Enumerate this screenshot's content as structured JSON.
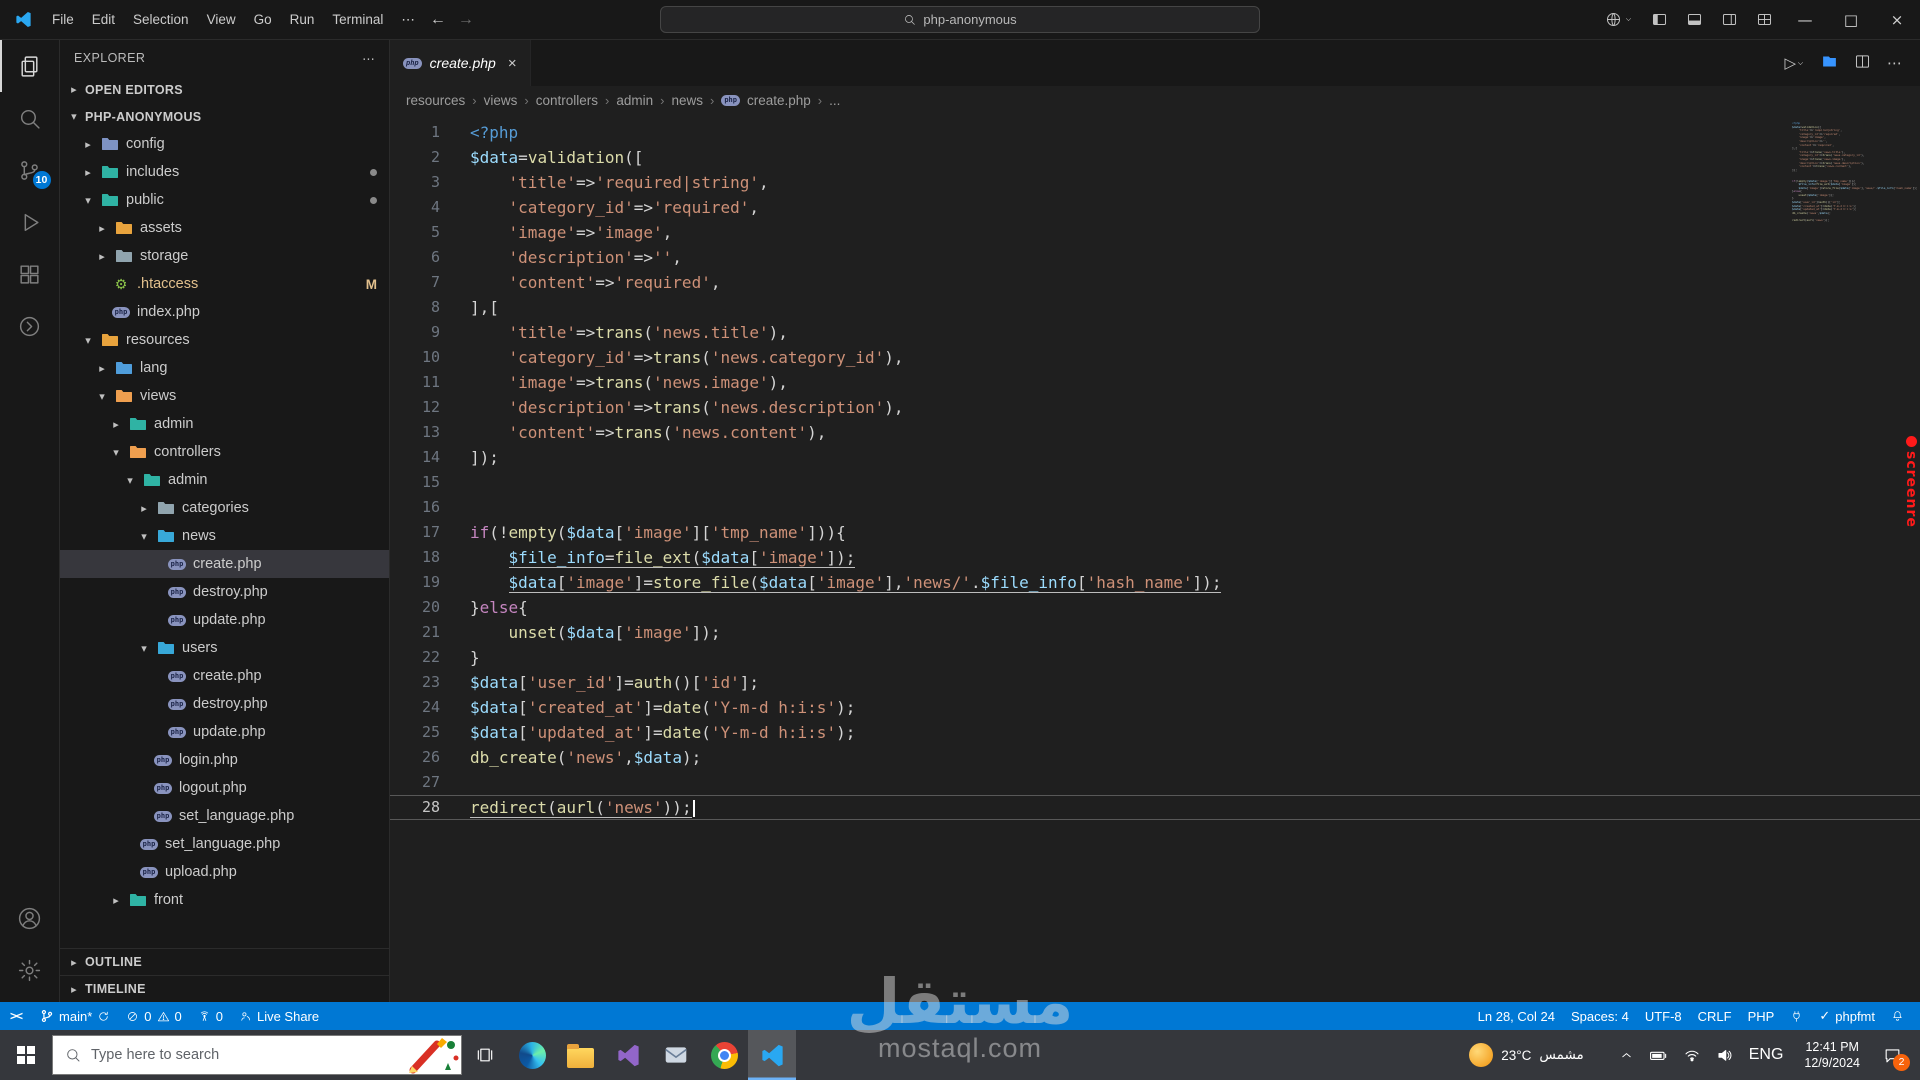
{
  "title_bar": {
    "menus": [
      "File",
      "Edit",
      "Selection",
      "View",
      "Go",
      "Run",
      "Terminal"
    ],
    "search": "php-anonymous"
  },
  "activity_bar": {
    "source_control_badge": "10"
  },
  "sidebar": {
    "title": "EXPLORER",
    "open_editors": "OPEN EDITORS",
    "root": "PHP-ANONYMOUS",
    "outline": "OUTLINE",
    "timeline": "TIMELINE",
    "tree": [
      {
        "label": "config",
        "type": "folder",
        "expanded": false,
        "level": 1,
        "color": "#7e93c4"
      },
      {
        "label": "includes",
        "type": "folder",
        "expanded": false,
        "level": 1,
        "color": "#2fb3a4",
        "dot": true
      },
      {
        "label": "public",
        "type": "folder",
        "expanded": true,
        "level": 1,
        "color": "#2fb3a4",
        "dot": true
      },
      {
        "label": "assets",
        "type": "folder",
        "expanded": false,
        "level": 2,
        "color": "#e8a33d"
      },
      {
        "label": "storage",
        "type": "folder",
        "expanded": false,
        "level": 2,
        "color": "#90a4ae"
      },
      {
        "label": ".htaccess",
        "type": "file",
        "ficon": "gear",
        "level": 2,
        "badge": "M",
        "mod": true
      },
      {
        "label": "index.php",
        "type": "file",
        "ficon": "php",
        "level": 2
      },
      {
        "label": "resources",
        "type": "folder",
        "expanded": true,
        "level": 1,
        "color": "#e8a33d"
      },
      {
        "label": "lang",
        "type": "folder",
        "expanded": false,
        "level": 2,
        "color": "#4f9ddb"
      },
      {
        "label": "views",
        "type": "folder",
        "expanded": true,
        "level": 2,
        "color": "#ef9f4f"
      },
      {
        "label": "admin",
        "type": "folder",
        "expanded": false,
        "level": 3,
        "color": "#2fb3a4"
      },
      {
        "label": "controllers",
        "type": "folder",
        "expanded": true,
        "level": 3,
        "color": "#ef9f4f"
      },
      {
        "label": "admin",
        "type": "folder",
        "expanded": true,
        "level": 4,
        "color": "#2fb3a4"
      },
      {
        "label": "categories",
        "type": "folder",
        "expanded": false,
        "level": 5,
        "color": "#90a4ae"
      },
      {
        "label": "news",
        "type": "folder",
        "expanded": true,
        "level": 5,
        "color": "#38a8d8"
      },
      {
        "label": "create.php",
        "type": "file",
        "ficon": "php",
        "level": 6,
        "selected": true
      },
      {
        "label": "destroy.php",
        "type": "file",
        "ficon": "php",
        "level": 6
      },
      {
        "label": "update.php",
        "type": "file",
        "ficon": "php",
        "level": 6
      },
      {
        "label": "users",
        "type": "folder",
        "expanded": true,
        "level": 5,
        "color": "#38a8d8"
      },
      {
        "label": "create.php",
        "type": "file",
        "ficon": "php",
        "level": 6
      },
      {
        "label": "destroy.php",
        "type": "file",
        "ficon": "php",
        "level": 6
      },
      {
        "label": "update.php",
        "type": "file",
        "ficon": "php",
        "level": 6
      },
      {
        "label": "login.php",
        "type": "file",
        "ficon": "php",
        "level": 5
      },
      {
        "label": "logout.php",
        "type": "file",
        "ficon": "php",
        "level": 5
      },
      {
        "label": "set_language.php",
        "type": "file",
        "ficon": "php",
        "level": 5
      },
      {
        "label": "set_language.php",
        "type": "file",
        "ficon": "php",
        "level": 4
      },
      {
        "label": "upload.php",
        "type": "file",
        "ficon": "php",
        "level": 4
      },
      {
        "label": "front",
        "type": "folder",
        "expanded": false,
        "level": 3,
        "color": "#2fb3a4"
      }
    ]
  },
  "editor": {
    "tab": {
      "label": "create.php"
    },
    "breadcrumbs": [
      "resources",
      "views",
      "controllers",
      "admin",
      "news",
      "create.php",
      "..."
    ],
    "active_line": 28,
    "underlined_lines": [
      18,
      19,
      28
    ],
    "code_lines": [
      "<?php",
      "$data=validation([",
      "    'title'=>'required|string',",
      "    'category_id'=>'required',",
      "    'image'=>'image',",
      "    'description'=>'',",
      "    'content'=>'required',",
      "],[",
      "    'title'=>trans('news.title'),",
      "    'category_id'=>trans('news.category_id'),",
      "    'image'=>trans('news.image'),",
      "    'description'=>trans('news.description'),",
      "    'content'=>trans('news.content'),",
      "]);",
      "",
      "",
      "if(!empty($data['image']['tmp_name'])){",
      "    $file_info=file_ext($data['image']);",
      "    $data['image']=store_file($data['image'],'news/'.$file_info['hash_name']);",
      "}else{",
      "    unset($data['image']);",
      "}",
      "$data['user_id']=auth()['id'];",
      "$data['created_at']=date('Y-m-d h:i:s');",
      "$data['updated_at']=date('Y-m-d h:i:s');",
      "db_create('news',$data);",
      "",
      "redirect(aurl('news'));"
    ]
  },
  "status_bar": {
    "branch": "main*",
    "errors": "0",
    "warnings": "0",
    "ports": "0",
    "live_share": "Live Share",
    "ln_col": "Ln 28, Col 24",
    "spaces": "Spaces: 4",
    "encoding": "UTF-8",
    "eol": "CRLF",
    "language": "PHP",
    "formatter": "phpfmt",
    "formatter_check": "✓"
  },
  "taskbar": {
    "search_placeholder": "Type here to search",
    "weather_temp": "23°C",
    "weather_desc": "مشمس",
    "lang": "ENG",
    "time": "12:41 PM",
    "date": "12/9/2024",
    "notification_count": "2"
  },
  "watermarks": {
    "screenrec": "screenre",
    "brand_ar": "مستقل",
    "brand_en": "mostaql.com"
  },
  "colors": {
    "accent": "#0078d4",
    "status_bar": "#0078d4",
    "selection": "#37373d",
    "git_modified": "#e2c08d",
    "php_icon": "#8993be",
    "badge_orange": "#f7630c"
  }
}
